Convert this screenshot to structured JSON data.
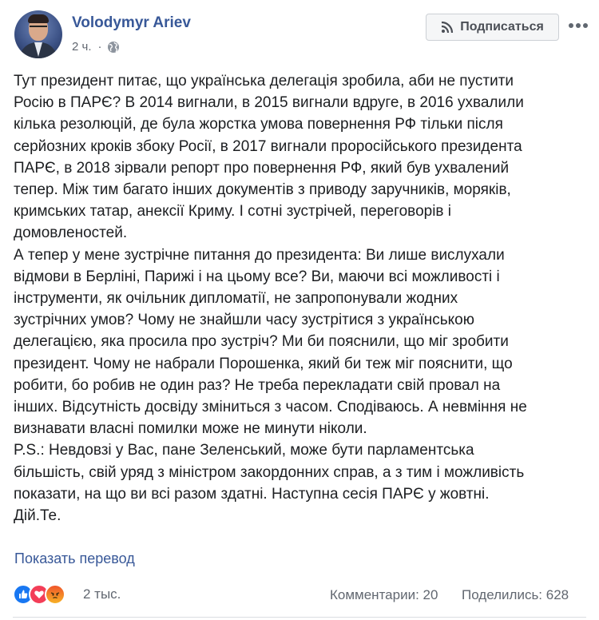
{
  "post": {
    "author": "Volodymyr Ariev",
    "time": "2 ч.",
    "dot": "·",
    "subscribe_label": "Подписаться",
    "text": "Тут президент питає, що українська делегація зробила, аби не пустити\nРосію в ПАРЄ? В 2014 вигнали, в 2015 вигнали вдруге, в 2016 ухвалили\nкілька резолюцій, де була жорстка умова повернення РФ тільки після\nсерйозних кроків збоку Росії, в 2017 вигнали проросійського президента\nПАРЄ, в 2018 зірвали репорт про повернення РФ, який був ухвалений\nтепер. Між тим багато інших документів з приводу заручників, моряків,\nкримських татар, анексії Криму. І сотні зустрічей, переговорів і\nдомовленостей.\nА тепер у мене зустрічне питання до президента: Ви лише вислухали\nвідмови в Берліні, Парижі і на цьому все? Ви, маючи всі можливості і\nінструменти, як очільник дипломатії, не запропонували жодних\nзустрічних умов? Чому не знайшли часу зустрітися з українською\nделегацією, яка просила про зустріч? Ми би пояснили, що міг зробити\nпрезидент. Чому не набрали Порошенка, який би теж міг пояснити, що\nробити, бо робив не один раз? Не треба перекладати свій провал на\nінших. Відсутність досвіду зміниться з часом. Сподіваюсь. А невміння не\nвизнавати власні помилки може не минути ніколи.\nP.S.: Невдовзі у Вас, пане Зеленський, може бути парламентська\nбільшість, свій уряд з міністром закордонних справ, а з тим і можливість\nпоказати, на що ви всі разом здатні. Наступна сесія ПАРЄ у жовтні.\nДій.Те.",
    "translate_label": "Показать перевод"
  },
  "footer": {
    "reactions": [
      "like-icon",
      "love-icon",
      "angry-icon"
    ],
    "reaction_count": "2 тыс.",
    "comments": "Комментарии: 20",
    "shares": "Поделились: 628"
  },
  "colors": {
    "link": "#385898",
    "meta": "#616770",
    "like": "#1877f2",
    "love": "#f33e58"
  }
}
